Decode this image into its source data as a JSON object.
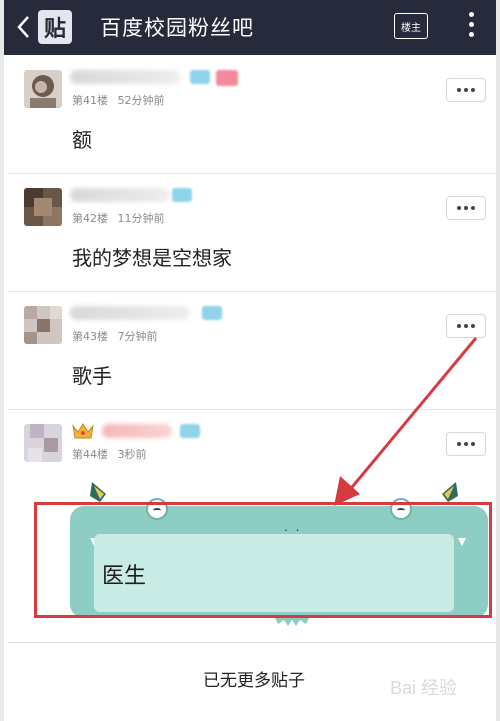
{
  "header": {
    "logo_char": "贴",
    "title": "百度校园粉丝吧",
    "op_label": "楼主"
  },
  "posts": [
    {
      "floor": "第41楼",
      "time": "52分钟前",
      "content": "额"
    },
    {
      "floor": "第42楼",
      "time": "11分钟前",
      "content": "我的梦想是空想家"
    },
    {
      "floor": "第43楼",
      "time": "7分钟前",
      "content": "歌手"
    },
    {
      "floor": "第44楼",
      "time": "3秒前",
      "content": ""
    }
  ],
  "new_reply": {
    "content": "医生",
    "mouth": ". ."
  },
  "footer": {
    "end_text": "已无更多贴子"
  },
  "watermark": {
    "text": "Bai 经验"
  },
  "colors": {
    "header_bg": "#262a3b",
    "monster": "#8ecdc3",
    "highlight": "#d63b40"
  }
}
